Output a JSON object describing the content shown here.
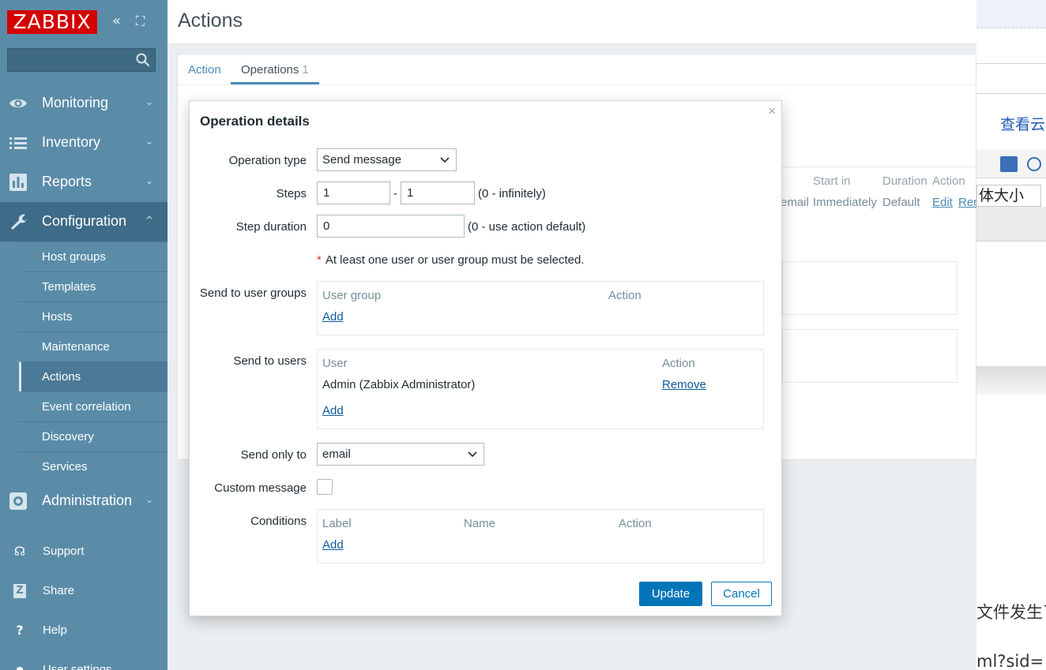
{
  "sidebar": {
    "logo": "ZABBIX",
    "collapse_icon": "«",
    "expand_icon": "⛶",
    "search": {
      "value": "",
      "placeholder": ""
    },
    "menu": [
      {
        "label": "Monitoring",
        "icon": "eye-icon"
      },
      {
        "label": "Inventory",
        "icon": "list-icon"
      },
      {
        "label": "Reports",
        "icon": "bar-chart-icon"
      },
      {
        "label": "Configuration",
        "icon": "wrench-icon"
      },
      {
        "label": "Administration",
        "icon": "gear-icon"
      }
    ],
    "chevron_down": "⌄",
    "chevron_up": "^",
    "submenu": [
      "Host groups",
      "Templates",
      "Hosts",
      "Maintenance",
      "Actions",
      "Event correlation",
      "Discovery",
      "Services"
    ],
    "bottom": [
      {
        "label": "Support",
        "icon": "headset-icon",
        "glyph": "☊"
      },
      {
        "label": "Share",
        "icon": "share-icon",
        "glyph": "Z"
      },
      {
        "label": "Help",
        "icon": "help-icon",
        "glyph": "?"
      },
      {
        "label": "User settings",
        "icon": "user-icon",
        "glyph": "●"
      }
    ]
  },
  "main": {
    "title": "Actions",
    "tabs": {
      "action": "Action",
      "operations": "Operations",
      "operations_count": "1"
    },
    "bg_table": {
      "headers": [
        "Start in",
        "Duration",
        "Action"
      ],
      "row": {
        "cell_partial": "email",
        "start": "Immediately",
        "duration": "Default",
        "edit": "Edit",
        "remove": "Rem"
      }
    }
  },
  "modal": {
    "title": "Operation details",
    "close": "×",
    "fields": {
      "operation_type": {
        "label": "Operation type",
        "value": "Send message"
      },
      "steps": {
        "label": "Steps",
        "from": "1",
        "sep": "-",
        "to": "1",
        "hint": "(0 - infinitely)"
      },
      "step_duration": {
        "label": "Step duration",
        "value": "0",
        "hint": "(0 - use action default)"
      },
      "required_note": "At least one user or user group must be selected.",
      "required_star": "*",
      "send_to_user_groups": {
        "label": "Send to user groups",
        "col1": "User group",
        "col2": "Action",
        "add": "Add"
      },
      "send_to_users": {
        "label": "Send to users",
        "col1": "User",
        "col2": "Action",
        "rows": [
          {
            "user": "Admin (Zabbix Administrator)",
            "action": "Remove"
          }
        ],
        "add": "Add"
      },
      "send_only_to": {
        "label": "Send only to",
        "value": "email"
      },
      "custom_message": {
        "label": "Custom message",
        "checked": false
      },
      "conditions": {
        "label": "Conditions",
        "col1": "Label",
        "col2": "Name",
        "col3": "Action",
        "add": "Add"
      }
    },
    "buttons": {
      "update": "Update",
      "cancel": "Cancel"
    }
  },
  "right_strip": {
    "text1": "查看云",
    "text2": "体大小",
    "text3": "文件发生了",
    "text4": "ml?sid="
  }
}
